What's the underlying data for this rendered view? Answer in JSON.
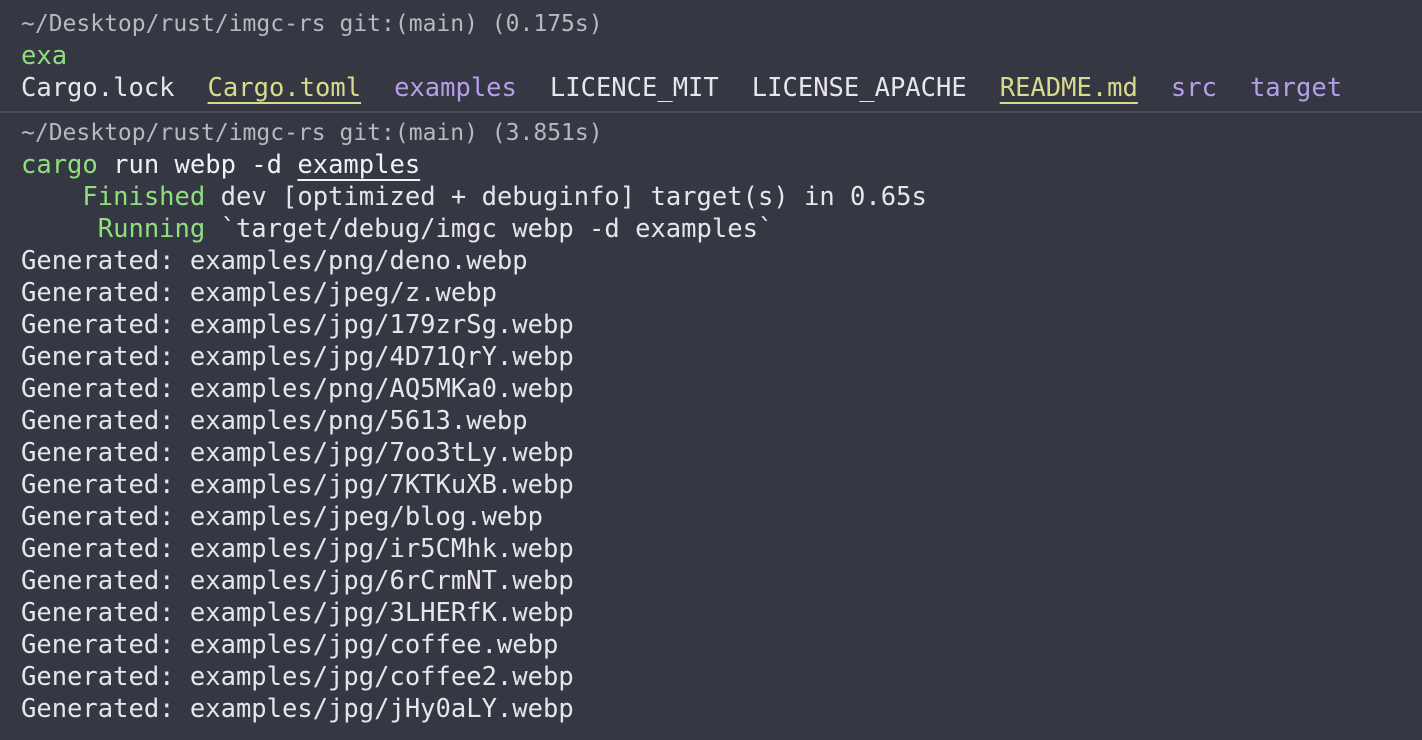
{
  "block1": {
    "prompt": "~/Desktop/rust/imgc-rs git:(main) (0.175s)",
    "command": "exa",
    "files": [
      {
        "name": "Cargo.lock",
        "style": "plain"
      },
      {
        "name": "Cargo.toml",
        "style": "yellow"
      },
      {
        "name": "examples",
        "style": "purple"
      },
      {
        "name": "LICENCE_MIT",
        "style": "plain"
      },
      {
        "name": "LICENSE_APACHE",
        "style": "plain"
      },
      {
        "name": "README.md",
        "style": "yellow"
      },
      {
        "name": "src",
        "style": "purple"
      },
      {
        "name": "target",
        "style": "purple"
      }
    ]
  },
  "block2": {
    "prompt": "~/Desktop/rust/imgc-rs git:(main) (3.851s)",
    "command": {
      "program": "cargo",
      "args": "run webp -d",
      "last_arg": "examples"
    },
    "finished": {
      "status": "Finished",
      "text": "dev [optimized + debuginfo] target(s) in 0.65s"
    },
    "running": {
      "status": "Running",
      "text": "`target/debug/imgc webp -d examples`"
    },
    "generated_prefix": "Generated:",
    "generated": [
      "examples/png/deno.webp",
      "examples/jpeg/z.webp",
      "examples/jpg/179zrSg.webp",
      "examples/jpg/4D71QrY.webp",
      "examples/png/AQ5MKa0.webp",
      "examples/png/5613.webp",
      "examples/jpg/7oo3tLy.webp",
      "examples/jpg/7KTKuXB.webp",
      "examples/jpeg/blog.webp",
      "examples/jpg/ir5CMhk.webp",
      "examples/jpg/6rCrmNT.webp",
      "examples/jpg/3LHERfK.webp",
      "examples/jpg/coffee.webp",
      "examples/jpg/coffee2.webp",
      "examples/jpg/jHy0aLY.webp"
    ]
  },
  "colors": {
    "background": "#353743",
    "prompt": "#b7b8c0",
    "command_green": "#8ee07f",
    "file_yellow": "#d9db8c",
    "file_purple": "#b79ee8",
    "text": "#e6e6ea"
  }
}
